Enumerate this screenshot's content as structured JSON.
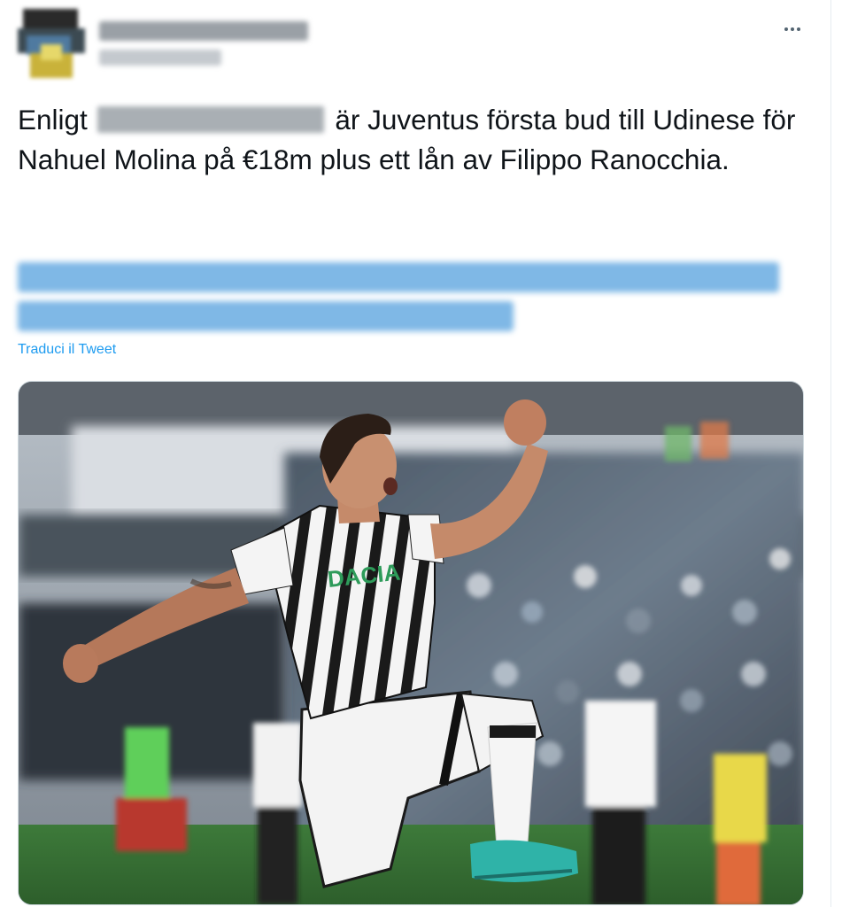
{
  "header": {
    "avatar_icon": "avatar",
    "more_icon": "more-horizontal-icon"
  },
  "tweet": {
    "text_part1": "Enligt",
    "text_part2": "är Juventus första bud till Udinese för Nahuel Molina på €18m plus ett lån av Filippo Ranocchia.",
    "translate_label": "Traduci il Tweet"
  },
  "photo": {
    "jersey_sponsor": "DACIA",
    "kit_colors": {
      "stripe_dark": "#1a1a1a",
      "stripe_light": "#f4f4f4",
      "boots": "#2fb3a8"
    }
  },
  "colors": {
    "text": "#0f1419",
    "link": "#1d9bf0",
    "muted": "#536471"
  }
}
